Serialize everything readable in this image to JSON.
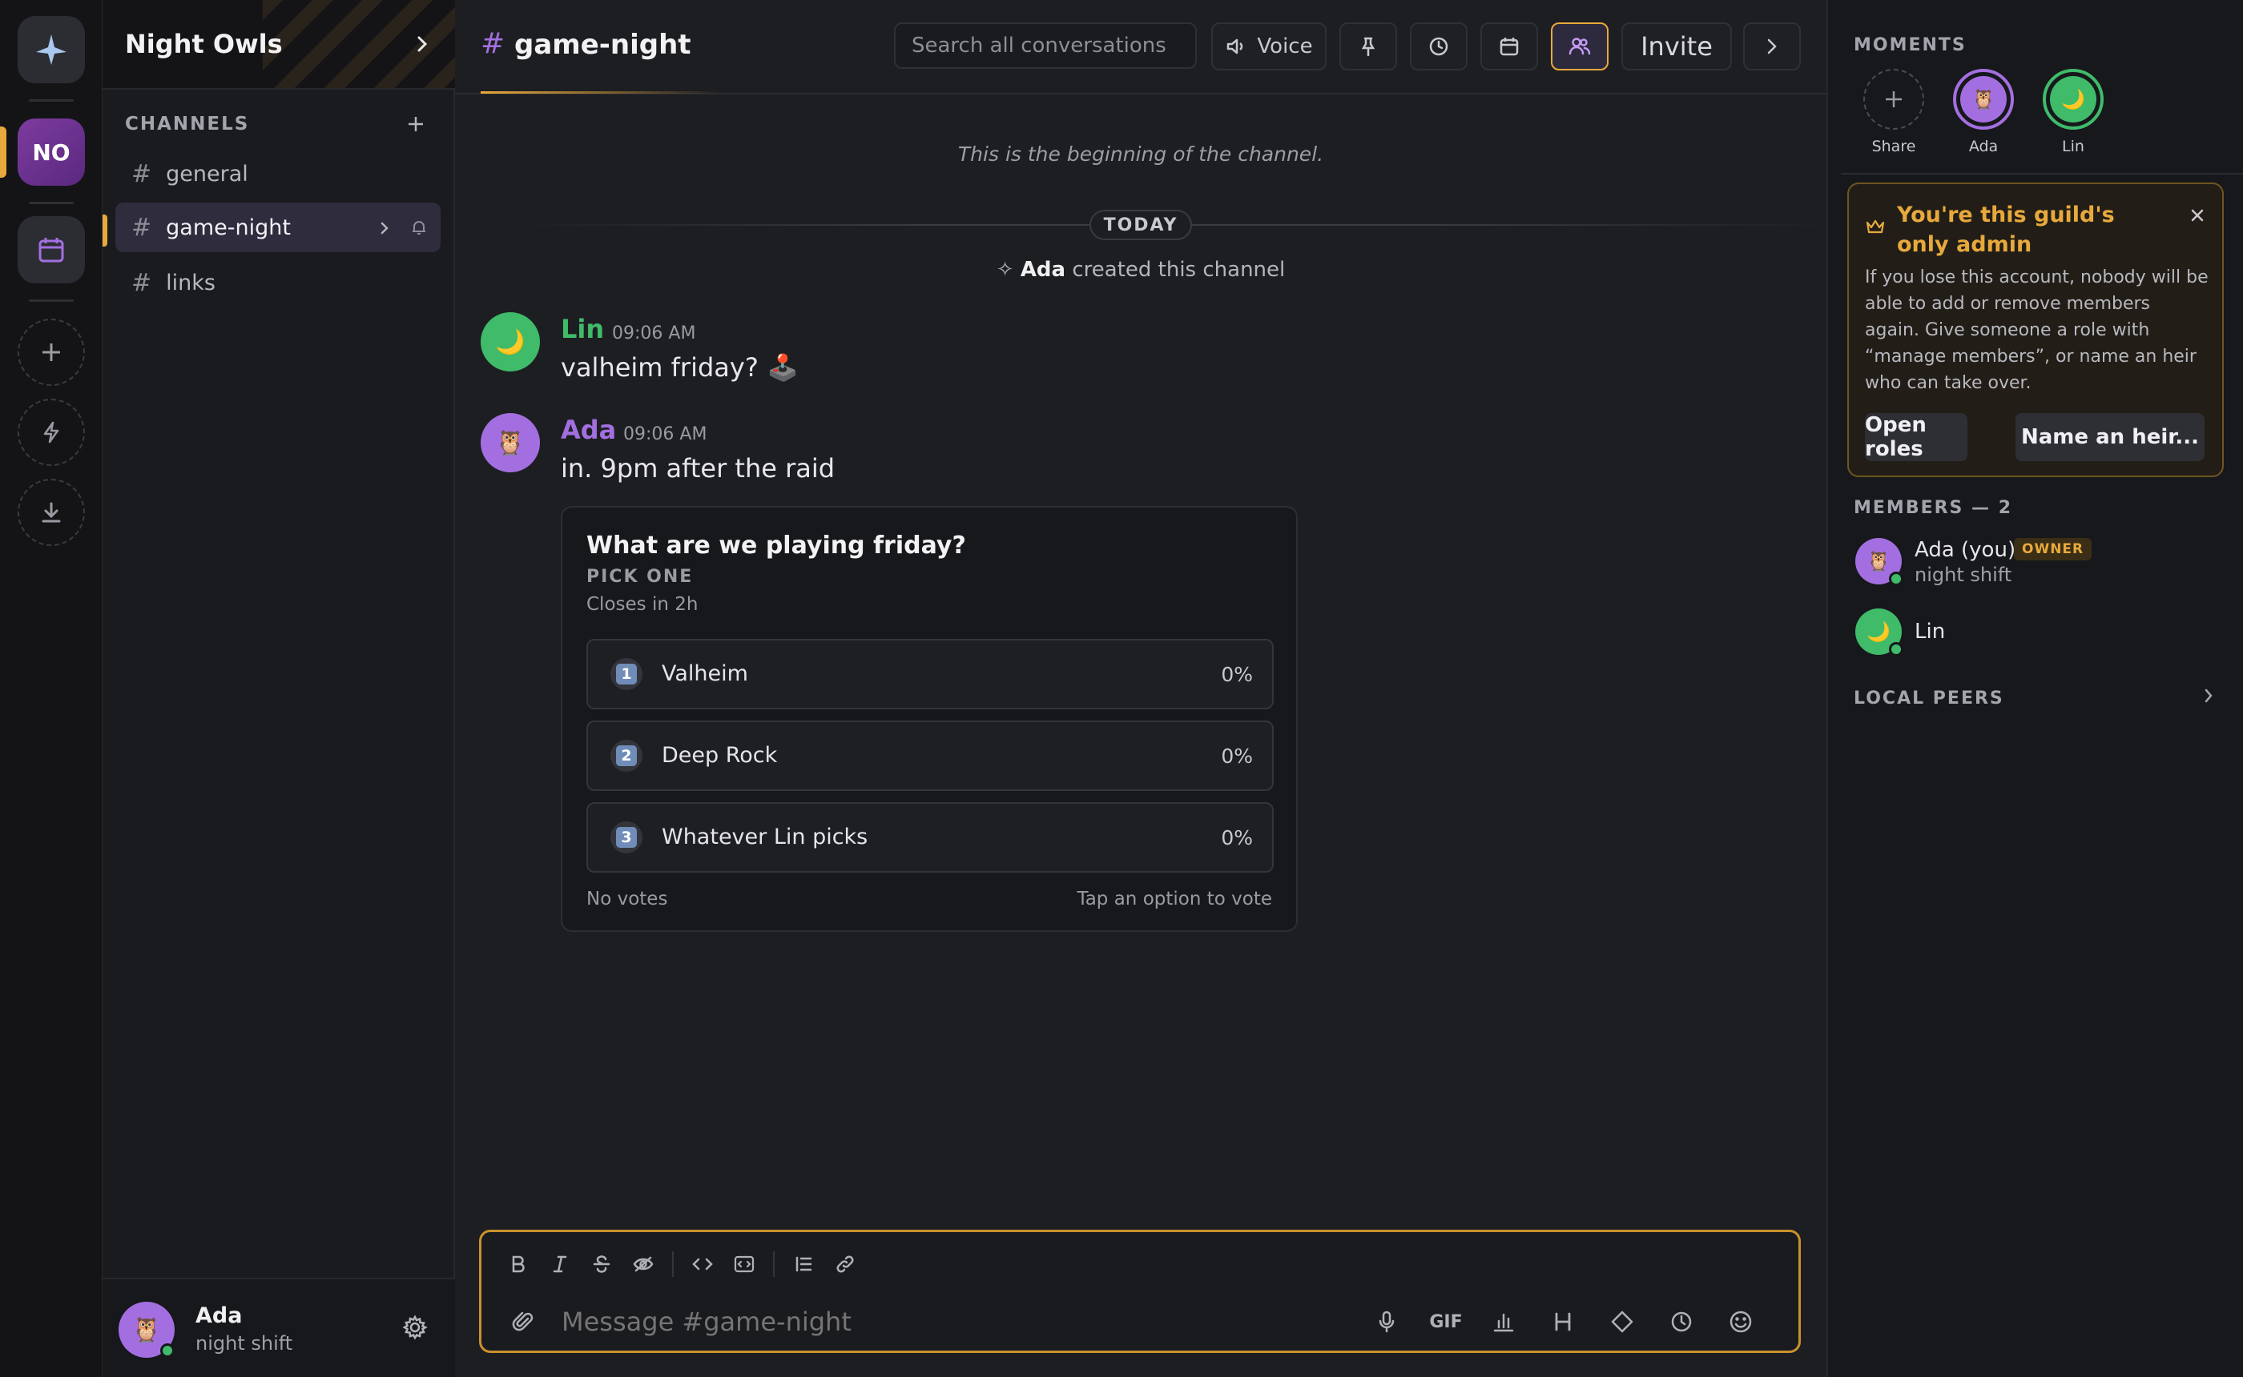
{
  "guild": {
    "name": "Night Owls",
    "rail_initials": "NO"
  },
  "channels": {
    "section_label": "CHANNELS",
    "items": [
      {
        "name": "general"
      },
      {
        "name": "game-night"
      },
      {
        "name": "links"
      }
    ]
  },
  "current_user": {
    "name": "Ada",
    "status": "night shift"
  },
  "header": {
    "channel": "game-night",
    "search_placeholder": "Search all conversations",
    "voice_label": "Voice",
    "invite_label": "Invite"
  },
  "messages": {
    "beginning": "This is the beginning of the channel.",
    "divider": "TODAY",
    "system": {
      "actor": "Ada",
      "action": "created this channel"
    },
    "list": [
      {
        "author": "Lin",
        "time": "09:06 AM",
        "text": "valheim friday? 🕹️",
        "color": "#3fbb6a"
      },
      {
        "author": "Ada",
        "time": "09:06 AM",
        "text": "in. 9pm after the raid",
        "color": "#a36fe0"
      }
    ]
  },
  "poll": {
    "question": "What are we playing friday?",
    "kind": "PICK ONE",
    "closes": "Closes in 2h",
    "options": [
      {
        "num": "1",
        "label": "Valheim",
        "percent": "0%"
      },
      {
        "num": "2",
        "label": "Deep Rock",
        "percent": "0%"
      },
      {
        "num": "3",
        "label": "Whatever Lin picks",
        "percent": "0%"
      }
    ],
    "footer_left": "No votes",
    "footer_right": "Tap an option to vote"
  },
  "composer": {
    "placeholder": "Message #game-night",
    "gif_label": "GIF"
  },
  "right_panel": {
    "moments_label": "MOMENTS",
    "moments": [
      {
        "label": "Share"
      },
      {
        "label": "Ada"
      },
      {
        "label": "Lin"
      }
    ],
    "admin_notice": {
      "title": "You're this guild's only admin",
      "body": "If you lose this account, nobody will be able to add or remove members again. Give someone a role with “manage members”, or name an heir who can take over.",
      "button_roles": "Open roles",
      "button_heir": "Name an heir..."
    },
    "members_label": "MEMBERS — 2",
    "members": [
      {
        "name": "Ada (you)",
        "badge": "OWNER",
        "status": "night shift"
      },
      {
        "name": "Lin"
      }
    ],
    "local_peers_label": "LOCAL PEERS"
  },
  "colors": {
    "accent": "#e8a93c",
    "purple": "#a36fe0",
    "green": "#3fbb6a",
    "background": "#1d1e22"
  },
  "icons": {
    "rail": [
      "app-logo-icon",
      "calendar-icon",
      "plus-icon",
      "lightning-icon",
      "download-icon"
    ],
    "header": [
      "speaker-icon",
      "pin-icon",
      "clock-icon",
      "calendar-icon",
      "members-icon",
      "chevron-right-icon"
    ],
    "composer": [
      "bold-icon",
      "italic-icon",
      "strikethrough-icon",
      "spoiler-icon",
      "code-icon",
      "code-block-icon",
      "list-icon",
      "link-icon",
      "attach-icon",
      "mic-icon",
      "poll-icon",
      "heading-icon",
      "diamond-icon",
      "clock-icon",
      "emoji-icon"
    ]
  }
}
